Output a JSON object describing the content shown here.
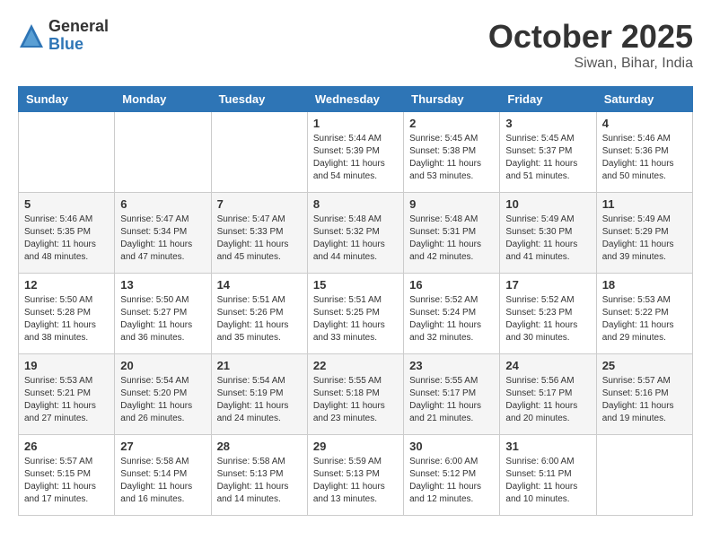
{
  "header": {
    "logo_general": "General",
    "logo_blue": "Blue",
    "title": "October 2025",
    "location": "Siwan, Bihar, India"
  },
  "calendar": {
    "days_of_week": [
      "Sunday",
      "Monday",
      "Tuesday",
      "Wednesday",
      "Thursday",
      "Friday",
      "Saturday"
    ],
    "weeks": [
      [
        {
          "day": "",
          "info": ""
        },
        {
          "day": "",
          "info": ""
        },
        {
          "day": "",
          "info": ""
        },
        {
          "day": "1",
          "info": "Sunrise: 5:44 AM\nSunset: 5:39 PM\nDaylight: 11 hours\nand 54 minutes."
        },
        {
          "day": "2",
          "info": "Sunrise: 5:45 AM\nSunset: 5:38 PM\nDaylight: 11 hours\nand 53 minutes."
        },
        {
          "day": "3",
          "info": "Sunrise: 5:45 AM\nSunset: 5:37 PM\nDaylight: 11 hours\nand 51 minutes."
        },
        {
          "day": "4",
          "info": "Sunrise: 5:46 AM\nSunset: 5:36 PM\nDaylight: 11 hours\nand 50 minutes."
        }
      ],
      [
        {
          "day": "5",
          "info": "Sunrise: 5:46 AM\nSunset: 5:35 PM\nDaylight: 11 hours\nand 48 minutes."
        },
        {
          "day": "6",
          "info": "Sunrise: 5:47 AM\nSunset: 5:34 PM\nDaylight: 11 hours\nand 47 minutes."
        },
        {
          "day": "7",
          "info": "Sunrise: 5:47 AM\nSunset: 5:33 PM\nDaylight: 11 hours\nand 45 minutes."
        },
        {
          "day": "8",
          "info": "Sunrise: 5:48 AM\nSunset: 5:32 PM\nDaylight: 11 hours\nand 44 minutes."
        },
        {
          "day": "9",
          "info": "Sunrise: 5:48 AM\nSunset: 5:31 PM\nDaylight: 11 hours\nand 42 minutes."
        },
        {
          "day": "10",
          "info": "Sunrise: 5:49 AM\nSunset: 5:30 PM\nDaylight: 11 hours\nand 41 minutes."
        },
        {
          "day": "11",
          "info": "Sunrise: 5:49 AM\nSunset: 5:29 PM\nDaylight: 11 hours\nand 39 minutes."
        }
      ],
      [
        {
          "day": "12",
          "info": "Sunrise: 5:50 AM\nSunset: 5:28 PM\nDaylight: 11 hours\nand 38 minutes."
        },
        {
          "day": "13",
          "info": "Sunrise: 5:50 AM\nSunset: 5:27 PM\nDaylight: 11 hours\nand 36 minutes."
        },
        {
          "day": "14",
          "info": "Sunrise: 5:51 AM\nSunset: 5:26 PM\nDaylight: 11 hours\nand 35 minutes."
        },
        {
          "day": "15",
          "info": "Sunrise: 5:51 AM\nSunset: 5:25 PM\nDaylight: 11 hours\nand 33 minutes."
        },
        {
          "day": "16",
          "info": "Sunrise: 5:52 AM\nSunset: 5:24 PM\nDaylight: 11 hours\nand 32 minutes."
        },
        {
          "day": "17",
          "info": "Sunrise: 5:52 AM\nSunset: 5:23 PM\nDaylight: 11 hours\nand 30 minutes."
        },
        {
          "day": "18",
          "info": "Sunrise: 5:53 AM\nSunset: 5:22 PM\nDaylight: 11 hours\nand 29 minutes."
        }
      ],
      [
        {
          "day": "19",
          "info": "Sunrise: 5:53 AM\nSunset: 5:21 PM\nDaylight: 11 hours\nand 27 minutes."
        },
        {
          "day": "20",
          "info": "Sunrise: 5:54 AM\nSunset: 5:20 PM\nDaylight: 11 hours\nand 26 minutes."
        },
        {
          "day": "21",
          "info": "Sunrise: 5:54 AM\nSunset: 5:19 PM\nDaylight: 11 hours\nand 24 minutes."
        },
        {
          "day": "22",
          "info": "Sunrise: 5:55 AM\nSunset: 5:18 PM\nDaylight: 11 hours\nand 23 minutes."
        },
        {
          "day": "23",
          "info": "Sunrise: 5:55 AM\nSunset: 5:17 PM\nDaylight: 11 hours\nand 21 minutes."
        },
        {
          "day": "24",
          "info": "Sunrise: 5:56 AM\nSunset: 5:17 PM\nDaylight: 11 hours\nand 20 minutes."
        },
        {
          "day": "25",
          "info": "Sunrise: 5:57 AM\nSunset: 5:16 PM\nDaylight: 11 hours\nand 19 minutes."
        }
      ],
      [
        {
          "day": "26",
          "info": "Sunrise: 5:57 AM\nSunset: 5:15 PM\nDaylight: 11 hours\nand 17 minutes."
        },
        {
          "day": "27",
          "info": "Sunrise: 5:58 AM\nSunset: 5:14 PM\nDaylight: 11 hours\nand 16 minutes."
        },
        {
          "day": "28",
          "info": "Sunrise: 5:58 AM\nSunset: 5:13 PM\nDaylight: 11 hours\nand 14 minutes."
        },
        {
          "day": "29",
          "info": "Sunrise: 5:59 AM\nSunset: 5:13 PM\nDaylight: 11 hours\nand 13 minutes."
        },
        {
          "day": "30",
          "info": "Sunrise: 6:00 AM\nSunset: 5:12 PM\nDaylight: 11 hours\nand 12 minutes."
        },
        {
          "day": "31",
          "info": "Sunrise: 6:00 AM\nSunset: 5:11 PM\nDaylight: 11 hours\nand 10 minutes."
        },
        {
          "day": "",
          "info": ""
        }
      ]
    ]
  }
}
